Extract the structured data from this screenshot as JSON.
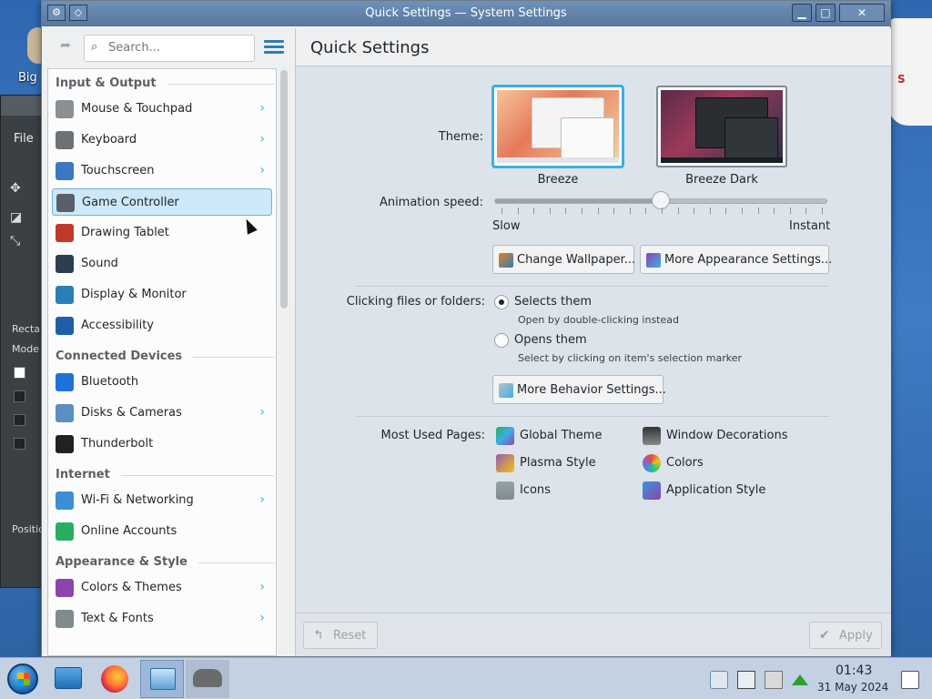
{
  "window": {
    "title": "Quick Settings — System Settings",
    "buttons": [
      "help-icon",
      "minimize-icon",
      "maximize-icon",
      "close-icon"
    ]
  },
  "desktop": {
    "icon_label": "Big",
    "bg_window_menu": "File",
    "bg_window_labels": [
      "Recta",
      "Mode",
      "Positio"
    ]
  },
  "sidebar": {
    "search_placeholder": "Search...",
    "sections": [
      {
        "title": "Input & Output",
        "items": [
          {
            "label": "Mouse & Touchpad",
            "icon": "mouse-icon",
            "has_submenu": true
          },
          {
            "label": "Keyboard",
            "icon": "keyboard-icon",
            "has_submenu": true
          },
          {
            "label": "Touchscreen",
            "icon": "touchscreen-icon",
            "has_submenu": true
          },
          {
            "label": "Game Controller",
            "icon": "gamepad-icon",
            "has_submenu": false,
            "active": true
          },
          {
            "label": "Drawing Tablet",
            "icon": "tablet-icon",
            "has_submenu": false
          },
          {
            "label": "Sound",
            "icon": "speaker-icon",
            "has_submenu": false
          },
          {
            "label": "Display & Monitor",
            "icon": "monitor-icon",
            "has_submenu": false
          },
          {
            "label": "Accessibility",
            "icon": "accessibility-icon",
            "has_submenu": false
          }
        ]
      },
      {
        "title": "Connected Devices",
        "items": [
          {
            "label": "Bluetooth",
            "icon": "bluetooth-icon",
            "has_submenu": false
          },
          {
            "label": "Disks & Cameras",
            "icon": "disks-icon",
            "has_submenu": true
          },
          {
            "label": "Thunderbolt",
            "icon": "thunderbolt-icon",
            "has_submenu": false
          }
        ]
      },
      {
        "title": "Internet",
        "items": [
          {
            "label": "Wi-Fi & Networking",
            "icon": "network-icon",
            "has_submenu": true
          },
          {
            "label": "Online Accounts",
            "icon": "online-accounts-icon",
            "has_submenu": false
          }
        ]
      },
      {
        "title": "Appearance & Style",
        "items": [
          {
            "label": "Colors & Themes",
            "icon": "colors-themes-icon",
            "has_submenu": true
          },
          {
            "label": "Text & Fonts",
            "icon": "fonts-icon",
            "has_submenu": true
          }
        ]
      }
    ]
  },
  "main": {
    "title": "Quick Settings",
    "theme_label": "Theme:",
    "themes": [
      {
        "name": "Breeze",
        "selected": true
      },
      {
        "name": "Breeze Dark",
        "selected": false
      }
    ],
    "animation_label": "Animation speed:",
    "animation_slow": "Slow",
    "animation_instant": "Instant",
    "animation_value": 0.5,
    "change_wallpaper": "Change Wallpaper...",
    "more_appearance": "More Appearance Settings...",
    "clicking_label": "Clicking files or folders:",
    "options": [
      {
        "label": "Selects them",
        "hint": "Open by double-clicking instead",
        "checked": true
      },
      {
        "label": "Opens them",
        "hint": "Select by clicking on item's selection marker",
        "checked": false
      }
    ],
    "more_behavior": "More Behavior Settings...",
    "most_used_label": "Most Used Pages:",
    "most_used": [
      {
        "label": "Global Theme",
        "icon": "global-theme-icon"
      },
      {
        "label": "Window Decorations",
        "icon": "window-decorations-icon"
      },
      {
        "label": "Plasma Style",
        "icon": "plasma-style-icon"
      },
      {
        "label": "Colors",
        "icon": "colors-icon"
      },
      {
        "label": "Icons",
        "icon": "icons-icon"
      },
      {
        "label": "Application Style",
        "icon": "application-style-icon"
      }
    ],
    "reset_label": "Reset",
    "apply_label": "Apply"
  },
  "taskbar": {
    "time": "01:43",
    "date": "31 May 2024"
  },
  "colors": {
    "accent": "#3daee9",
    "titlebar": "#5f81a9",
    "selection_bg": "#cde8f7"
  }
}
